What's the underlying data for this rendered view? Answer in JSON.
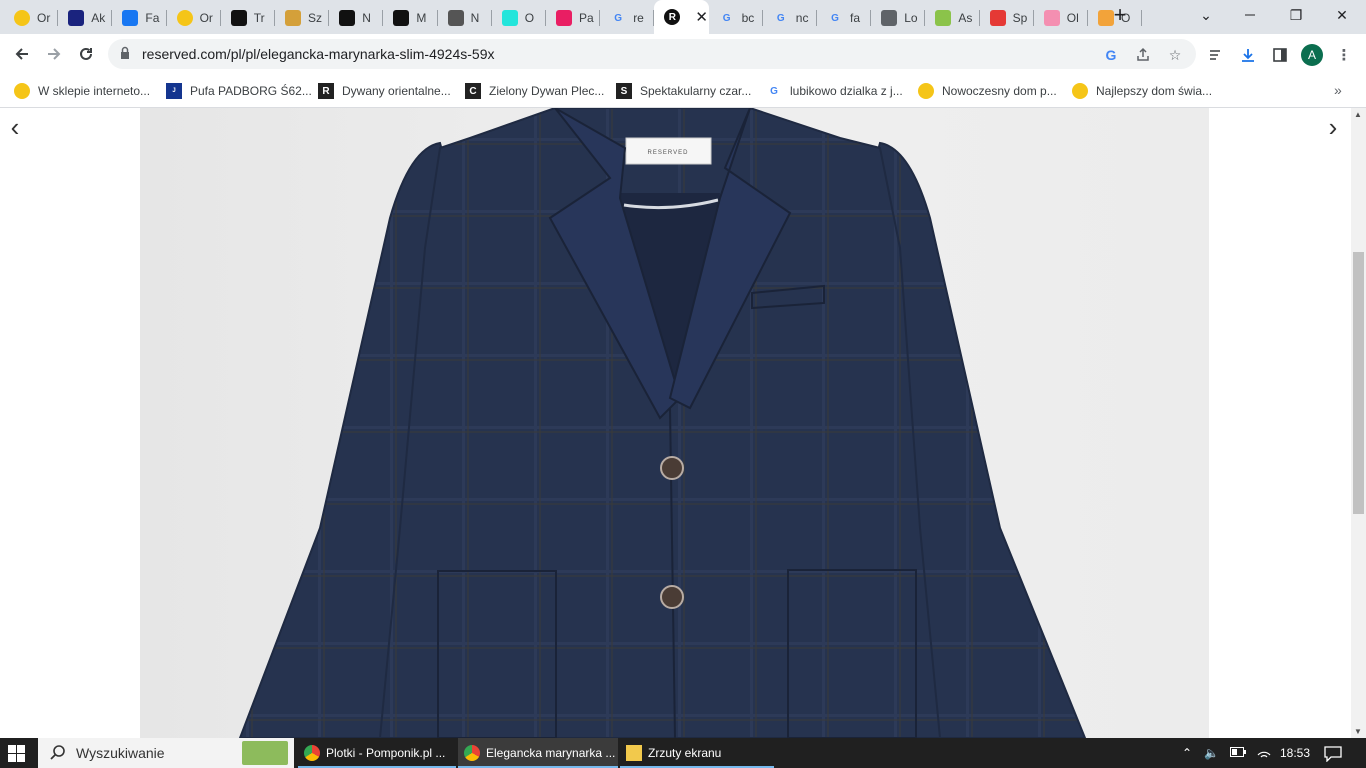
{
  "browser": {
    "tabs": [
      {
        "label": "Or",
        "favicon": "yellow-circle-icon",
        "color": "#f5c518"
      },
      {
        "label": "Ak",
        "favicon": "mail-icon",
        "color": "#1a237e"
      },
      {
        "label": "Fa",
        "favicon": "facebook-icon",
        "color": "#1877f2"
      },
      {
        "label": "Or",
        "favicon": "yellow-circle-icon",
        "color": "#f5c518"
      },
      {
        "label": "Tr",
        "favicon": "tr-icon",
        "color": "#111111"
      },
      {
        "label": "Sz",
        "favicon": "crown-icon",
        "color": "#d4a03a"
      },
      {
        "label": "N",
        "favicon": "p-icon",
        "color": "#111111"
      },
      {
        "label": "M",
        "favicon": "p-icon",
        "color": "#111111"
      },
      {
        "label": "N",
        "favicon": "m-icon",
        "color": "#555555"
      },
      {
        "label": "O",
        "favicon": "olx-icon",
        "color": "#23e5db"
      },
      {
        "label": "Pa",
        "favicon": "grid-icon",
        "color": "#e91e63"
      },
      {
        "label": "re",
        "favicon": "google-icon",
        "color": "#4285f4"
      },
      {
        "label": "",
        "favicon": "reserved-icon",
        "color": "#111111",
        "active": true
      },
      {
        "label": "bc",
        "favicon": "google-icon",
        "color": "#4285f4"
      },
      {
        "label": "nc",
        "favicon": "google-icon",
        "color": "#4285f4"
      },
      {
        "label": "fa",
        "favicon": "google-icon",
        "color": "#4285f4"
      },
      {
        "label": "Lo",
        "favicon": "globe-icon",
        "color": "#5f6368"
      },
      {
        "label": "As",
        "favicon": "leaf-icon",
        "color": "#8bc34a"
      },
      {
        "label": "Sp",
        "favicon": "star-burst-icon",
        "color": "#e53935"
      },
      {
        "label": "Ol",
        "favicon": "t-icon",
        "color": "#f48fb1"
      },
      {
        "label": "O",
        "favicon": "u-icon",
        "color": "#f2a33a"
      }
    ],
    "new_tab": "+",
    "window": {
      "minimize": "⌄",
      "restore": "❐",
      "close": "✕"
    },
    "url": "reserved.com/pl/pl/elegancka-marynarka-slim-4924s-59x",
    "avatar_letter": "A",
    "accent": "#0b6e4f"
  },
  "bookmarks": [
    {
      "label": "W sklepie interneto...",
      "icon": "yellow-circle-icon"
    },
    {
      "label": "Pufa PADBORG Ś62...",
      "icon": "jysk-icon"
    },
    {
      "label": "Dywany orientalne...",
      "icon": "r-icon"
    },
    {
      "label": "Zielony Dywan Plec...",
      "icon": "c-icon"
    },
    {
      "label": "Spektakularny czar...",
      "icon": "s-icon"
    },
    {
      "label": "lubikowo dzialka z j...",
      "icon": "google-icon"
    },
    {
      "label": "Nowoczesny dom p...",
      "icon": "yellow-circle-icon"
    },
    {
      "label": "Najlepszy dom świa...",
      "icon": "yellow-circle-icon"
    }
  ],
  "bookmarks_more": "»",
  "gallery": {
    "prev": "‹",
    "next": "›",
    "label_text": "RESERVED"
  },
  "taskbar": {
    "search_placeholder": "Wyszukiwanie",
    "tasks": [
      {
        "label": "Plotki - Pomponik.pl ...",
        "icon": "chrome-icon"
      },
      {
        "label": "Elegancka marynarka ...",
        "icon": "chrome-icon",
        "active": true
      },
      {
        "label": "Zrzuty ekranu",
        "icon": "folder-icon"
      }
    ],
    "time": "18:53"
  }
}
